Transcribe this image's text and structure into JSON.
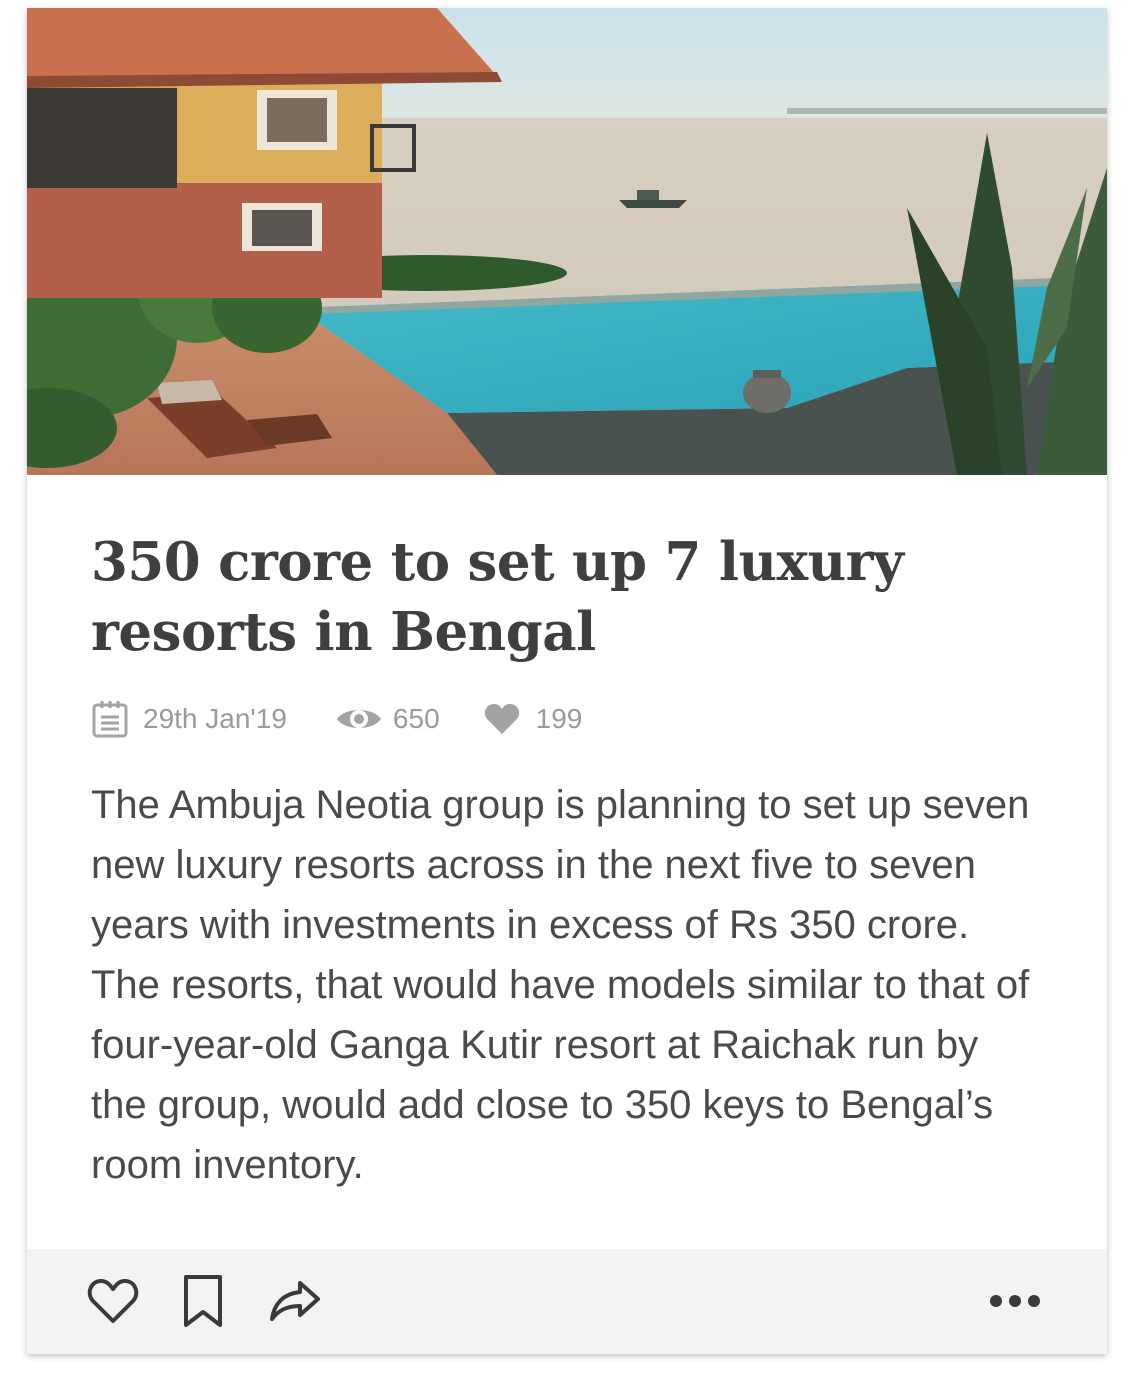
{
  "article": {
    "image_alt": "Resort with infinity pool overlooking river",
    "title": "350 crore to set up 7 luxury resorts in Bengal",
    "date": "29th Jan'19",
    "views": "650",
    "likes": "199",
    "description": "The Ambuja Neotia group is planning to set up seven new luxury resorts across in the next five to seven years with investments in excess of Rs 350 crore. The resorts, that would have models similar to that of four-year-old Ganga Kutir resort at Raichak run by the group, would add close to 350 keys to Bengal’s room inventory."
  },
  "icons": {
    "date": "calendar-icon",
    "views": "eye-icon",
    "likes": "heart-filled-icon",
    "like_action": "heart-outline-icon",
    "bookmark_action": "bookmark-icon",
    "share_action": "share-icon",
    "more_action": "more-dots-icon"
  },
  "colors": {
    "title": "#3f3f3f",
    "meta": "#9a9a9a",
    "body_text": "#4a4a4a",
    "footer_bg": "#f3f3f3",
    "action_icon": "#3a3a3a"
  }
}
